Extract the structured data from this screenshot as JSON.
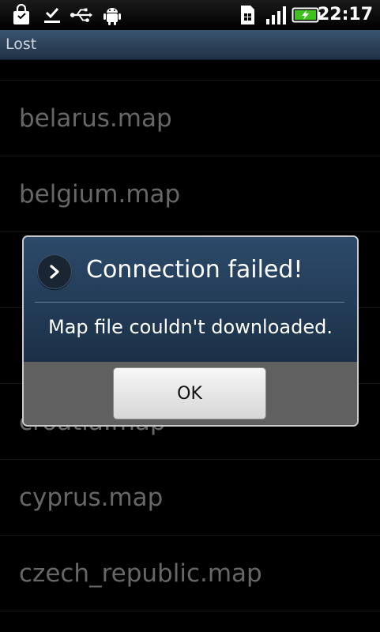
{
  "status_bar": {
    "time": "22:17",
    "icons": [
      "shopping-bag-icon",
      "download-done-icon",
      "usb-icon",
      "android-debug-icon",
      "sim-card-icon",
      "signal-icon",
      "battery-charging-icon"
    ]
  },
  "title_bar": {
    "title": "Lost"
  },
  "list": {
    "items": [
      "belarus.map",
      "belgium.map",
      "",
      "",
      "croatia.map",
      "cyprus.map",
      "czech_republic.map"
    ]
  },
  "dialog": {
    "title": "Connection failed!",
    "message": "Map file couldn't downloaded.",
    "ok_label": "OK",
    "icon": "chevron-right-icon"
  },
  "colors": {
    "title_bar": "#1f3146",
    "dialog": "#233a55",
    "footer": "#606060"
  }
}
